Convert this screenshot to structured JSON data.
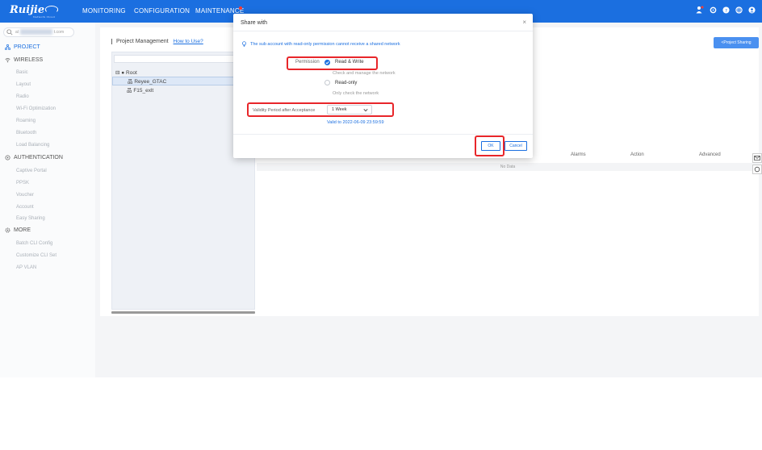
{
  "brand": {
    "name": "Ruijie",
    "sub": "Network Cloud"
  },
  "nav": {
    "monitoring": "MONITORING",
    "configuration": "CONFIGURATION",
    "maintenance": "MAINTENANCE"
  },
  "sidebar": {
    "search_prefix": "al",
    "search_suffix": "t.com",
    "project": "PROJECT",
    "wireless": "WIRELESS",
    "wireless_items": [
      "Basic",
      "Layout",
      "Radio",
      "Wi-Fi Optimization",
      "Roaming",
      "Bluetooth",
      "Load Balancing"
    ],
    "authentication": "AUTHENTICATION",
    "auth_items": [
      "Captive Portal",
      "PPSK",
      "Voucher",
      "Account",
      "Easy Sharing"
    ],
    "more": "MORE",
    "more_items": [
      "Batch CLI Config",
      "Customize CLI Set",
      "AP VLAN"
    ]
  },
  "main": {
    "title": "Project Management",
    "how_to": "How to Use?",
    "share_button": "<Project Sharing",
    "tree": {
      "root": "Root",
      "nodes": [
        "Reyee_GTAC",
        "F15_exlt"
      ]
    },
    "columns": [
      "Alarms",
      "Action",
      "Advanced"
    ],
    "no_data": "No Data"
  },
  "modal": {
    "title": "Share with",
    "close": "×",
    "notice": "The sub account with read-only permission cannot receive a shared network",
    "permission_label": "Permission",
    "options": [
      {
        "label": "Read & Write",
        "hint": "Check and manage the network"
      },
      {
        "label": "Read-only",
        "hint": "Only check the network"
      }
    ],
    "validity_label": "Validity Period after Acceptance",
    "validity_value": "1 Week",
    "valid_to": "Valid to 2022-06-09 23:59:59",
    "ok": "OK",
    "cancel": "Cancel"
  },
  "colors": {
    "primary": "#1b6fe0",
    "highlight": "#e8262a"
  }
}
